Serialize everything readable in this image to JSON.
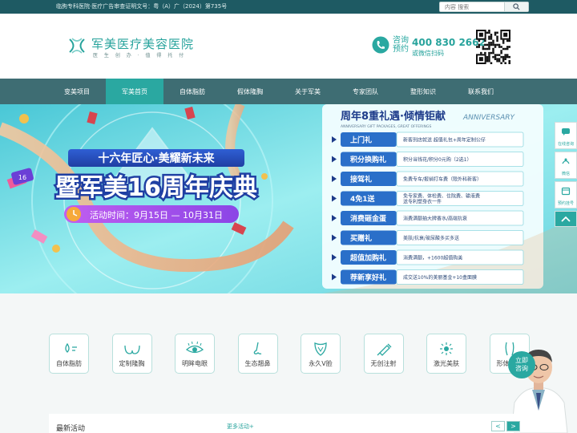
{
  "topbar": {
    "notice": "临朐专科医院·医疗广告审查证明文号：粤（A）广（2024）第735号",
    "search_placeholder": "内容 搜索"
  },
  "header": {
    "brand": "军美医疗美容医院",
    "slogan": "医 生 创 办 · 值 得 托 付",
    "consult_line1": "咨询",
    "consult_line2": "预约",
    "phone": "400 830 2662",
    "scan_text": "或微信扫码"
  },
  "nav": {
    "items": [
      "变美项目",
      "军美首页",
      "自体脂肪",
      "假体隆胸",
      "关于军美",
      "专家团队",
      "整形知识",
      "联系我们"
    ],
    "active_index": 1
  },
  "banner": {
    "tagline": "十六年匠心·美耀新未来",
    "headline": "暨军美16周年庆典",
    "activity_time": "活动时间：9月15日 — 10月31日",
    "badge_number": "16",
    "gift_title": "周年8重礼遇·倾情钜献",
    "gift_title_en": "ANNIVERSARY",
    "gift_subtitle": "ANNIVERSARY GIFT PACKAGES, GREAT OFFERINGS",
    "gifts": [
      {
        "name": "上门礼",
        "desc": "新客到店就送 超值礼包+周年定制公仔"
      },
      {
        "name": "积分换购礼",
        "desc": "积分当钱花/积分0元购（2选1）"
      },
      {
        "name": "接驾礼",
        "desc": "免费专车/报销打车费（限外科新客）"
      },
      {
        "name": "4免1送",
        "desc": "免专家费、体检费、住院费、输液费 送专利塑身衣一件"
      },
      {
        "name": "消费砸金蛋",
        "desc": "消费满额抽大牌香水/高端抗衰"
      },
      {
        "name": "买赠礼",
        "desc": "美肤/抗衰/玻尿酸多买多送"
      },
      {
        "name": "超值加购礼",
        "desc": "消费满额，+1600超值购美"
      },
      {
        "name": "荐新享好礼",
        "desc": "成交送10%的美丽基金+10盒面膜"
      }
    ]
  },
  "side_tools": [
    {
      "icon": "chat-icon",
      "label": "在线咨询"
    },
    {
      "icon": "wechat-icon",
      "label": "微信"
    },
    {
      "icon": "calendar-icon",
      "label": "预约挂号"
    }
  ],
  "categories": [
    {
      "label": "自体脂肪",
      "icon": "fat-transfer-icon"
    },
    {
      "label": "定制隆胸",
      "icon": "breast-icon"
    },
    {
      "label": "明眸电眼",
      "icon": "eye-icon"
    },
    {
      "label": "生态翘鼻",
      "icon": "nose-icon"
    },
    {
      "label": "永久V脸",
      "icon": "v-face-icon"
    },
    {
      "label": "无创注射",
      "icon": "syringe-icon"
    },
    {
      "label": "激光美肤",
      "icon": "laser-icon"
    },
    {
      "label": "形体雕塑",
      "icon": "body-contour-icon"
    }
  ],
  "consult_bubble": {
    "line1": "立即",
    "line2": "咨询"
  },
  "activities": {
    "title": "最新活动",
    "more": "更多活动+",
    "prev": "<",
    "next": ">"
  },
  "colors": {
    "brand": "#27a39c",
    "nav_bg": "#3e6d73",
    "topbar_bg": "#1e5a63",
    "gift_label": "#2a6fc9",
    "banner_bg": "#7fe0e8"
  }
}
